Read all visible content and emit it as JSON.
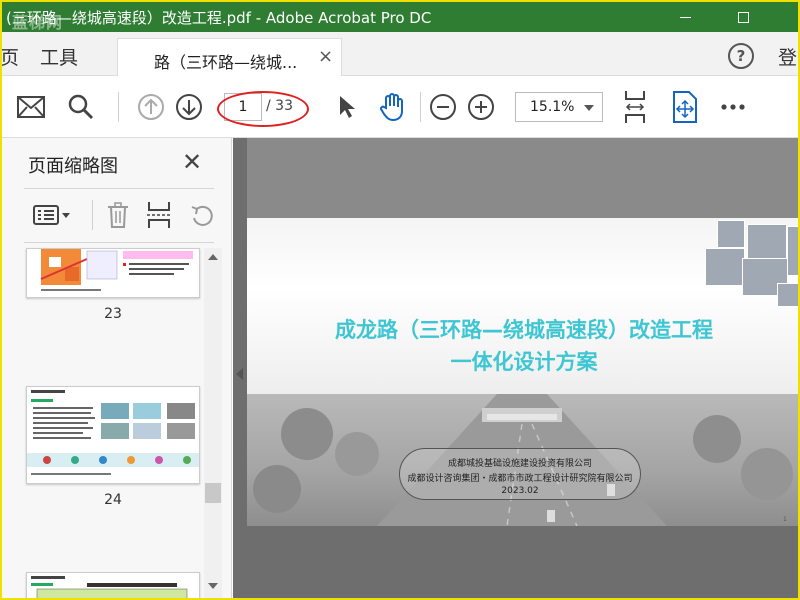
{
  "window": {
    "title": "(三环路—绕城高速段）改造工程.pdf - Adobe Acrobat Pro DC",
    "watermark": "蓝梯网"
  },
  "tabs": {
    "partial_left": "页",
    "tools": "工具",
    "document_tab": "路（三环路—绕城...",
    "close_symbol": "×",
    "help_symbol": "?",
    "login_partial": "登"
  },
  "toolbar": {
    "current_page": "1",
    "total_pages": "/ 33",
    "zoom": "15.1%"
  },
  "panel": {
    "title": "页面缩略图",
    "close_symbol": "✕",
    "page_numbers": [
      "23",
      "24"
    ]
  },
  "document": {
    "title_line1": "成龙路（三环路—绕城高速段）改造工程",
    "title_line2": "一体化设计方案",
    "org_line1": "成都城投基础设施建设投资有限公司",
    "org_line2": "成都设计咨询集团・成都市市政工程设计研究院有限公司",
    "date": "2023.02",
    "page_marker": "1"
  },
  "colors": {
    "titlebar": "#2e7d32",
    "title_text": "#3ec6d3",
    "highlight_circle": "#e02020",
    "frame_border": "#f0e000"
  }
}
